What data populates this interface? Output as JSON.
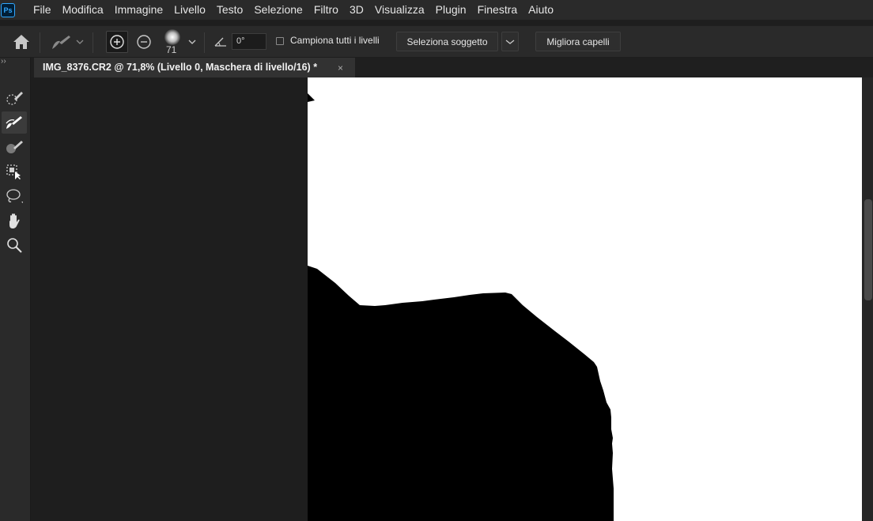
{
  "app": {
    "logo_text": "Ps",
    "accent_color": "#31a8ff"
  },
  "menu": [
    "File",
    "Modifica",
    "Immagine",
    "Livello",
    "Testo",
    "Selezione",
    "Filtro",
    "3D",
    "Visualizza",
    "Plugin",
    "Finestra",
    "Aiuto"
  ],
  "options": {
    "brush_size": "71",
    "angle_value": "0°",
    "sample_all_layers_label": "Campiona tutti i livelli",
    "sample_all_layers_checked": false,
    "select_subject_label": "Seleziona soggetto",
    "refine_hair_label": "Migliora capelli"
  },
  "document": {
    "tab_title": "IMG_8376.CR2 @ 71,8% (Livello 0, Maschera di livello/16) *",
    "close_glyph": "×"
  },
  "tools": [
    {
      "name": "quick-selection-icon",
      "active": false
    },
    {
      "name": "refine-edge-brush-icon",
      "active": true
    },
    {
      "name": "brush-icon",
      "active": false
    },
    {
      "name": "object-selection-icon",
      "active": false
    },
    {
      "name": "lasso-icon",
      "active": false
    },
    {
      "name": "hand-icon",
      "active": false
    },
    {
      "name": "zoom-icon",
      "active": false
    }
  ],
  "toolbar": {
    "collapse_glyph": "››"
  }
}
